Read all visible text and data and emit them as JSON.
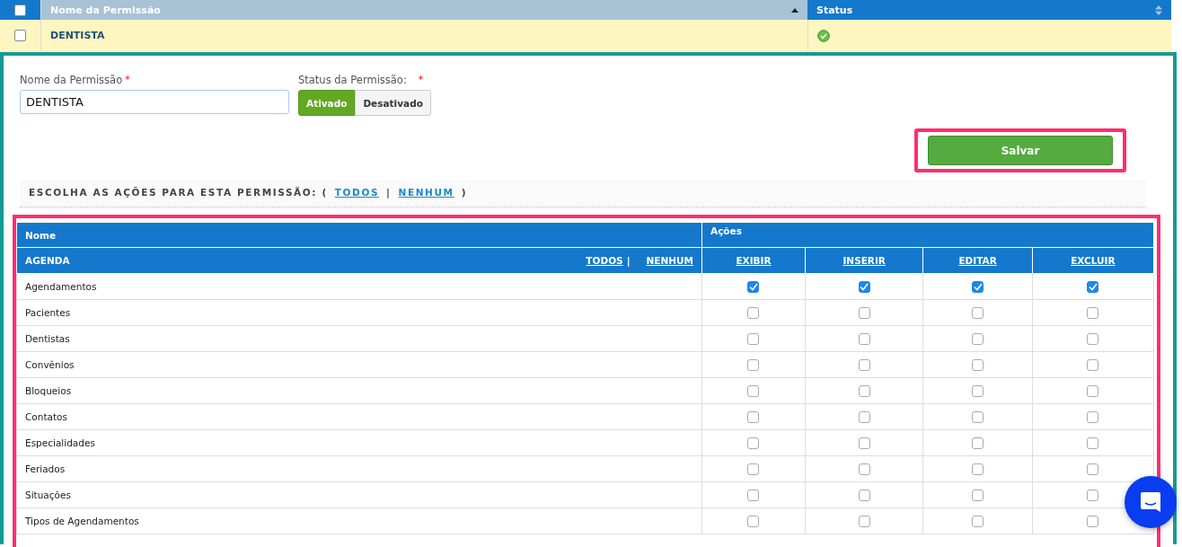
{
  "grid": {
    "columns": [
      {
        "label": "Nome da Permissão",
        "sorted": true
      },
      {
        "label": "Status",
        "sorted": false
      }
    ],
    "rows": [
      {
        "name": "DENTISTA",
        "checked": false,
        "active": true
      }
    ],
    "header_checked": false
  },
  "form": {
    "name_label": "Nome da Permissão",
    "name_required": "*",
    "status_required": "*",
    "name_value": "DENTISTA",
    "status_label": "Status da Permissão:",
    "status_options": [
      {
        "label": "Ativado",
        "selected": true
      },
      {
        "label": "Desativado",
        "selected": false
      }
    ],
    "save": "Salvar"
  },
  "choose": {
    "text": "ESCOLHA AS AÇÕES PARA ESTA PERMISSÃO: (",
    "all": "TODOS",
    "sep": "|",
    "none": "NENHUM",
    "close": ")"
  },
  "perm_table": {
    "name_header": "Nome",
    "actions_header": "Ações",
    "group": "AGENDA",
    "group_all": "TODOS",
    "group_sep": "|",
    "group_none": "NENHUM",
    "actions": [
      "EXIBIR",
      "INSERIR",
      "EDITAR",
      "EXCLUIR"
    ],
    "rows": [
      {
        "name": "Agendamentos",
        "checks": [
          true,
          true,
          true,
          true
        ]
      },
      {
        "name": "Pacientes",
        "checks": [
          false,
          false,
          false,
          false
        ]
      },
      {
        "name": "Dentistas",
        "checks": [
          false,
          false,
          false,
          false
        ]
      },
      {
        "name": "Convênios",
        "checks": [
          false,
          false,
          false,
          false
        ]
      },
      {
        "name": "Bloqueios",
        "checks": [
          false,
          false,
          false,
          false
        ]
      },
      {
        "name": "Contatos",
        "checks": [
          false,
          false,
          false,
          false
        ]
      },
      {
        "name": "Especialidades",
        "checks": [
          false,
          false,
          false,
          false
        ]
      },
      {
        "name": "Feriados",
        "checks": [
          false,
          false,
          false,
          false
        ]
      },
      {
        "name": "Situações",
        "checks": [
          false,
          false,
          false,
          false
        ]
      },
      {
        "name": "Tipos de Agendamentos",
        "checks": [
          false,
          false,
          false,
          false
        ]
      }
    ]
  }
}
